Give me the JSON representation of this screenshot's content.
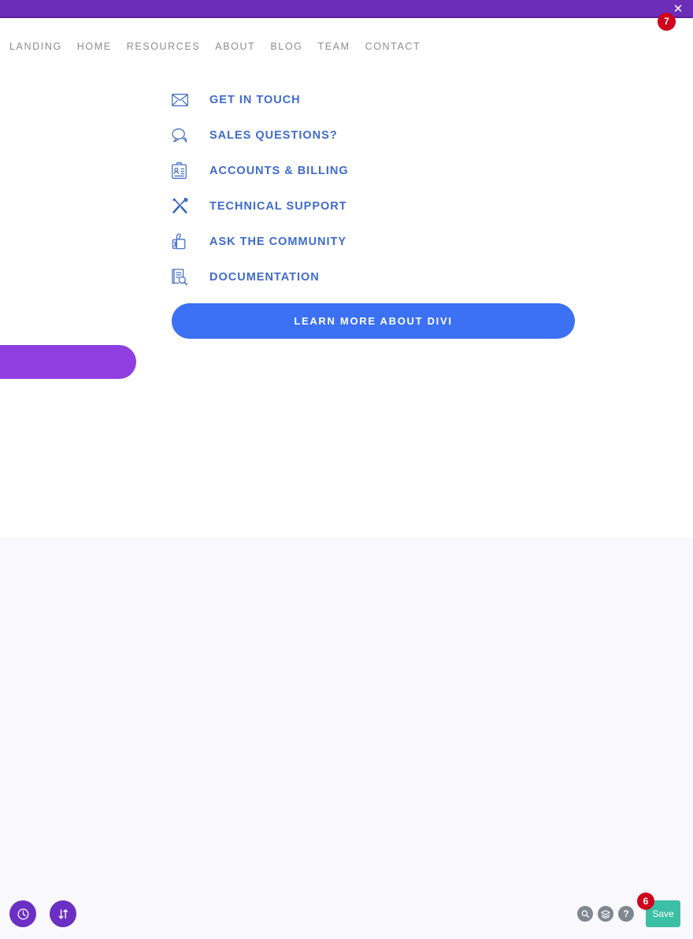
{
  "admin_bar": {
    "close_label": "✕",
    "close_icon": "close-icon",
    "badge_count": "7",
    "bar_color": "#6c2eb9"
  },
  "site_nav": {
    "items": [
      {
        "label": "LANDING"
      },
      {
        "label": "HOME"
      },
      {
        "label": "RESOURCES"
      },
      {
        "label": "ABOUT"
      },
      {
        "label": "BLOG"
      },
      {
        "label": "TEAM"
      },
      {
        "label": "CONTACT"
      }
    ]
  },
  "link_list": {
    "accent_color": "#3f6bcb",
    "items": [
      {
        "label": "GET IN TOUCH",
        "icon": "envelope-icon"
      },
      {
        "label": "SALES QUESTIONS?",
        "icon": "chat-bubble-icon"
      },
      {
        "label": "ACCOUNTS & BILLING",
        "icon": "id-card-icon"
      },
      {
        "label": "TECHNICAL SUPPORT",
        "icon": "tools-icon"
      },
      {
        "label": "ASK THE COMMUNITY",
        "icon": "thumbs-up-icon"
      },
      {
        "label": "DOCUMENTATION",
        "icon": "document-search-icon"
      }
    ]
  },
  "cta": {
    "label": "LEARN MORE ABOUT DIVI",
    "color": "#3b71f2"
  },
  "purple_pill": {
    "color": "#8f3fe0"
  },
  "builder_toolbar": {
    "left_buttons": [
      {
        "name": "history-button",
        "icon": "clock-icon"
      },
      {
        "name": "reorder-button",
        "icon": "arrows-up-down-icon"
      }
    ],
    "right_buttons": [
      {
        "name": "zoom-button",
        "icon": "magnifier-icon"
      },
      {
        "name": "layers-button",
        "icon": "layers-icon"
      },
      {
        "name": "help-button",
        "icon": "question-mark-icon",
        "glyph": "?"
      }
    ],
    "save": {
      "label": "Save",
      "color": "#3bbfa5",
      "badge_count": "6"
    }
  }
}
